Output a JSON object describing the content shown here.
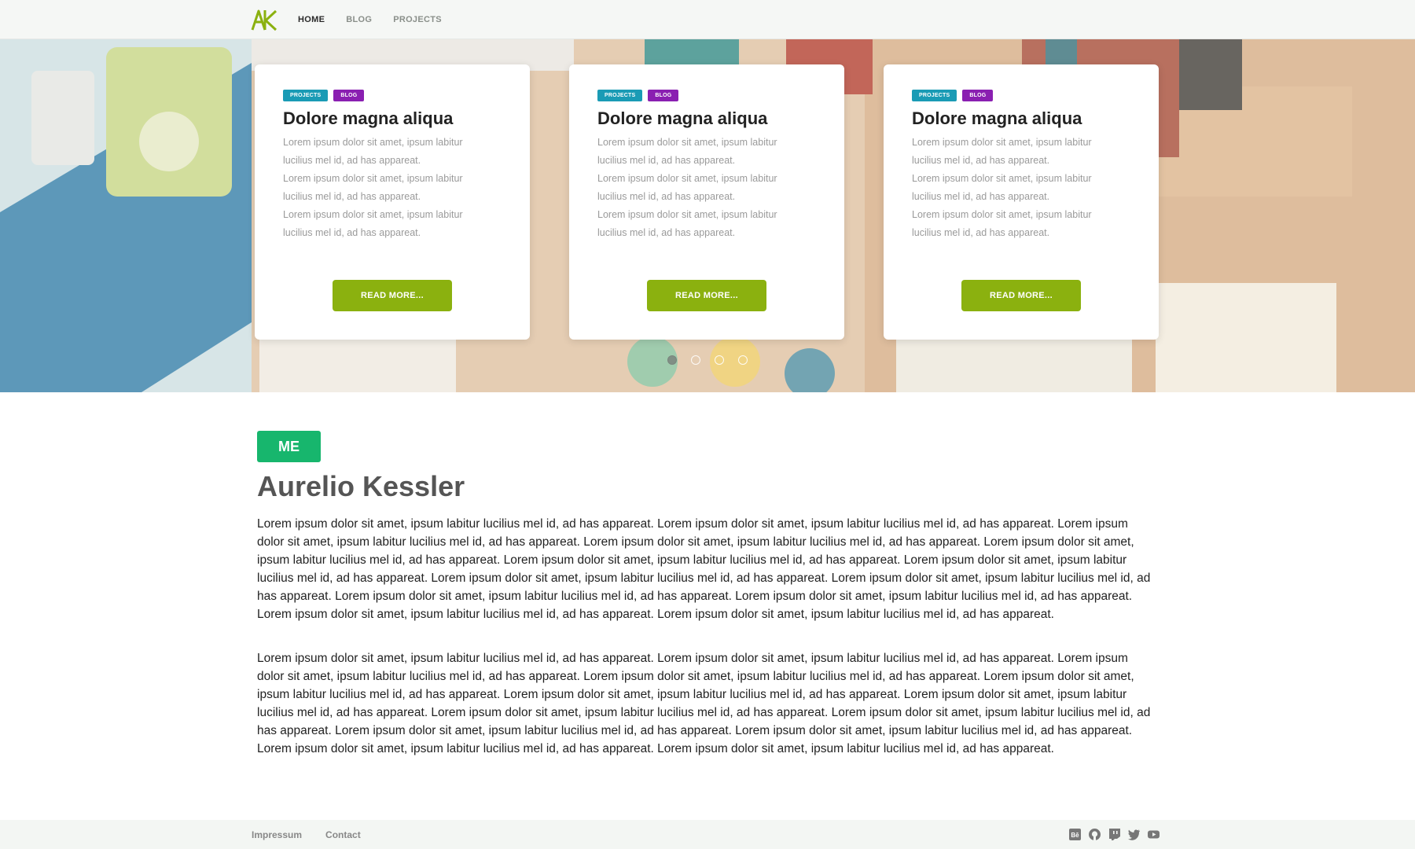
{
  "header": {
    "logo_text": "AK",
    "nav": [
      {
        "label": "HOME",
        "active": true
      },
      {
        "label": "BLOG",
        "active": false
      },
      {
        "label": "PROJECTS",
        "active": false
      }
    ]
  },
  "hero": {
    "cards": [
      {
        "tags": [
          "PROJECTS",
          "BLOG"
        ],
        "title": "Dolore magna aliqua",
        "lines": [
          "Lorem ipsum dolor sit amet, ipsum labitur",
          "lucilius mel id, ad has appareat.",
          "Lorem ipsum dolor sit amet, ipsum labitur",
          "lucilius mel id, ad has appareat.",
          "Lorem ipsum dolor sit amet, ipsum labitur",
          "lucilius mel id, ad has appareat."
        ],
        "button": "READ MORE..."
      },
      {
        "tags": [
          "PROJECTS",
          "BLOG"
        ],
        "title": "Dolore magna aliqua",
        "lines": [
          "Lorem ipsum dolor sit amet, ipsum labitur",
          "lucilius mel id, ad has appareat.",
          "Lorem ipsum dolor sit amet, ipsum labitur",
          "lucilius mel id, ad has appareat.",
          "Lorem ipsum dolor sit amet, ipsum labitur",
          "lucilius mel id, ad has appareat."
        ],
        "button": "READ MORE..."
      },
      {
        "tags": [
          "PROJECTS",
          "BLOG"
        ],
        "title": "Dolore magna aliqua",
        "lines": [
          "Lorem ipsum dolor sit amet, ipsum labitur",
          "lucilius mel id, ad has appareat.",
          "Lorem ipsum dolor sit amet, ipsum labitur",
          "lucilius mel id, ad has appareat.",
          "Lorem ipsum dolor sit amet, ipsum labitur",
          "lucilius mel id, ad has appareat."
        ],
        "button": "READ MORE..."
      }
    ],
    "carousel": {
      "count": 4,
      "active_index": 0
    }
  },
  "about": {
    "badge": "ME",
    "name": "Aurelio Kessler",
    "paragraphs": [
      "Lorem ipsum dolor sit amet, ipsum labitur lucilius mel id, ad has appareat. Lorem ipsum dolor sit amet, ipsum labitur lucilius mel id, ad has appareat. Lorem ipsum dolor sit amet, ipsum labitur lucilius mel id, ad has appareat. Lorem ipsum dolor sit amet, ipsum labitur lucilius mel id, ad has appareat. Lorem ipsum dolor sit amet, ipsum labitur lucilius mel id, ad has appareat. Lorem ipsum dolor sit amet, ipsum labitur lucilius mel id, ad has appareat. Lorem ipsum dolor sit amet, ipsum labitur lucilius mel id, ad has appareat. Lorem ipsum dolor sit amet, ipsum labitur lucilius mel id, ad has appareat. Lorem ipsum dolor sit amet, ipsum labitur lucilius mel id, ad has appareat. Lorem ipsum dolor sit amet, ipsum labitur lucilius mel id, ad has appareat. Lorem ipsum dolor sit amet, ipsum labitur lucilius mel id, ad has appareat. Lorem ipsum dolor sit amet, ipsum labitur lucilius mel id, ad has appareat. Lorem ipsum dolor sit amet, ipsum labitur lucilius mel id, ad has appareat.",
      "Lorem ipsum dolor sit amet, ipsum labitur lucilius mel id, ad has appareat. Lorem ipsum dolor sit amet, ipsum labitur lucilius mel id, ad has appareat. Lorem ipsum dolor sit amet, ipsum labitur lucilius mel id, ad has appareat. Lorem ipsum dolor sit amet, ipsum labitur lucilius mel id, ad has appareat. Lorem ipsum dolor sit amet, ipsum labitur lucilius mel id, ad has appareat. Lorem ipsum dolor sit amet, ipsum labitur lucilius mel id, ad has appareat. Lorem ipsum dolor sit amet, ipsum labitur lucilius mel id, ad has appareat. Lorem ipsum dolor sit amet, ipsum labitur lucilius mel id, ad has appareat. Lorem ipsum dolor sit amet, ipsum labitur lucilius mel id, ad has appareat. Lorem ipsum dolor sit amet, ipsum labitur lucilius mel id, ad has appareat. Lorem ipsum dolor sit amet, ipsum labitur lucilius mel id, ad has appareat. Lorem ipsum dolor sit amet, ipsum labitur lucilius mel id, ad has appareat. Lorem ipsum dolor sit amet, ipsum labitur lucilius mel id, ad has appareat."
    ]
  },
  "footer": {
    "links": [
      "Impressum",
      "Contact"
    ],
    "social_icons": [
      "behance-icon",
      "github-icon",
      "twitch-icon",
      "twitter-icon",
      "youtube-icon"
    ]
  },
  "colors": {
    "accent": "#8bb10f",
    "badge": "#17b66d",
    "tag_projects": "#1a9bb5",
    "tag_blog": "#8a1fb1"
  }
}
